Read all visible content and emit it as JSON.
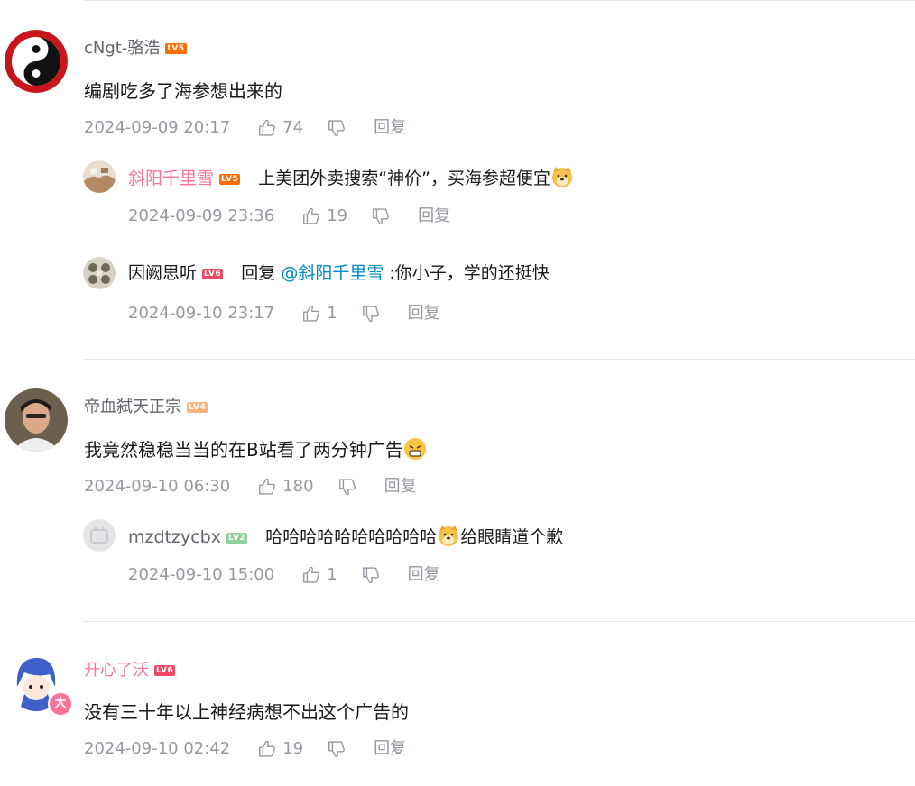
{
  "comments": [
    {
      "user": "cNgt-骆浩",
      "level": "LV5",
      "text": "编剧吃多了海参想出来的",
      "time": "2024-09-09 20:17",
      "likes": "74",
      "reply_label": "回复",
      "replies": [
        {
          "user": "斜阳千里雪",
          "level": "LV5",
          "text": "上美团外卖搜索“神价”，买海参超便宜",
          "time": "2024-09-09 23:36",
          "likes": "19",
          "reply_label": "回复"
        },
        {
          "user": "因阙思听",
          "level": "LV6",
          "prefix": "回复 ",
          "mention": "@斜阳千里雪",
          "text": " :你小子，学的还挺快",
          "time": "2024-09-10 23:17",
          "likes": "1",
          "reply_label": "回复"
        }
      ]
    },
    {
      "user": "帝血弑天正宗",
      "level": "LV4",
      "text": "我竟然稳稳当当的在B站看了两分钟广告",
      "time": "2024-09-10 06:30",
      "likes": "180",
      "reply_label": "回复",
      "replies": [
        {
          "user": "mzdtzycbx",
          "level": "LV2",
          "text": "哈哈哈哈哈哈哈哈哈哈",
          "text2": "给眼睛道个歉",
          "time": "2024-09-10 15:00",
          "likes": "1",
          "reply_label": "回复"
        }
      ]
    },
    {
      "user": "开心了沃",
      "level": "LV6",
      "badge": "大",
      "text": "没有三十年以上神经病想不出这个广告的",
      "time": "2024-09-10 02:42",
      "likes": "19",
      "reply_label": "回复"
    }
  ]
}
